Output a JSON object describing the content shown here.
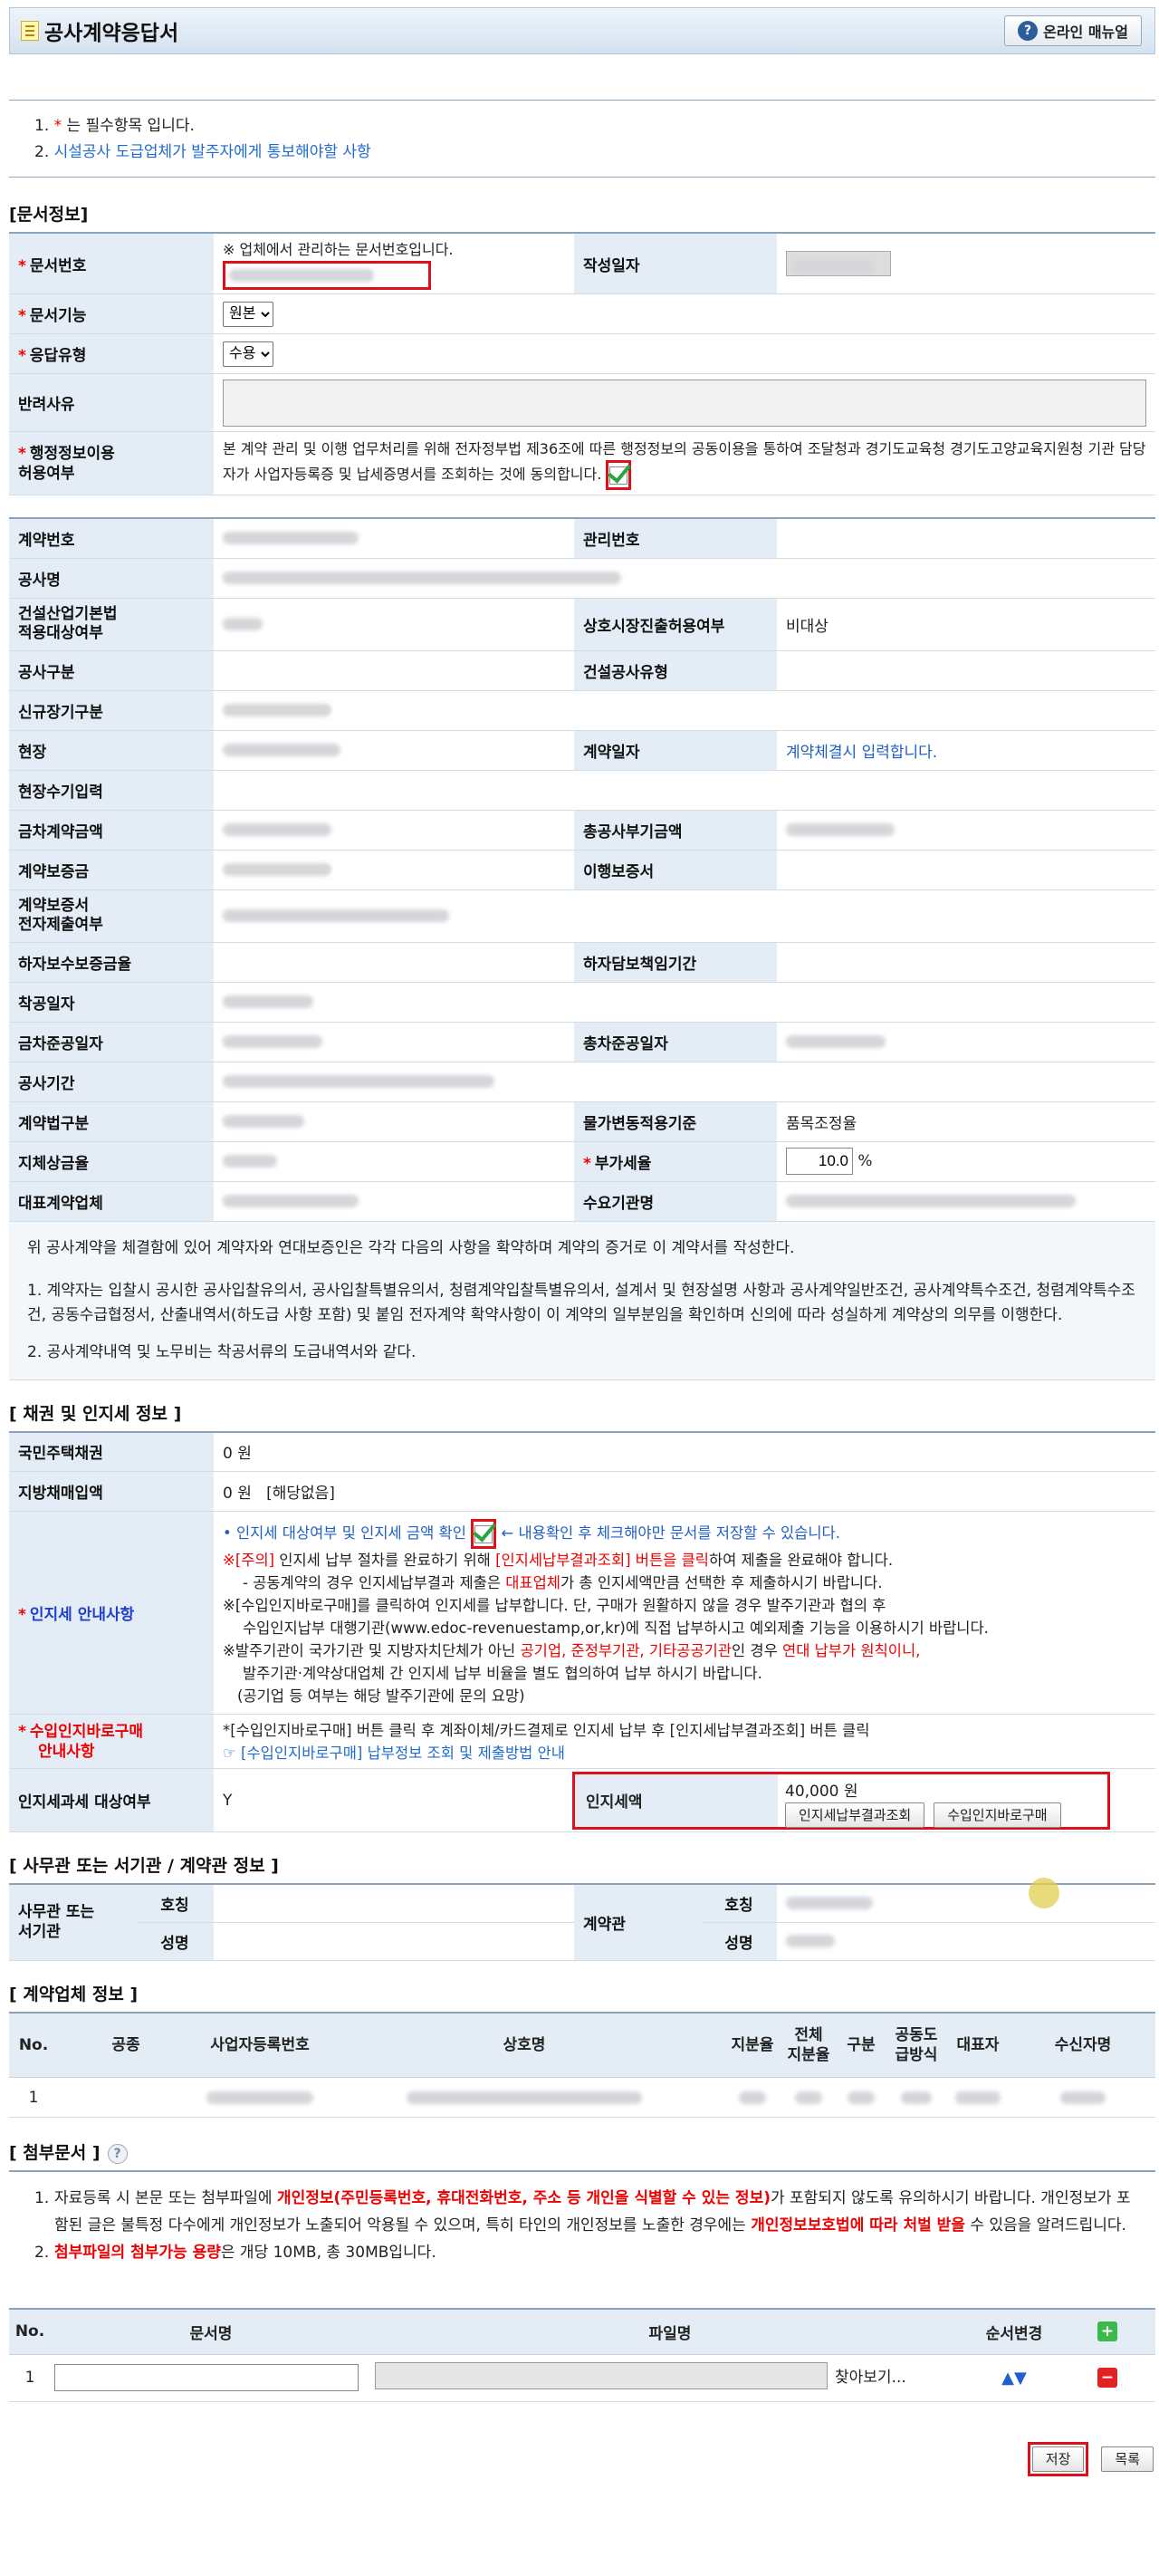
{
  "header": {
    "title": "공사계약응답서",
    "manual_label": "온라인 매뉴얼"
  },
  "notice": {
    "n1": "1.",
    "star": "*",
    "t1": " 는 필수항목 입니다.",
    "n2": "2.",
    "link": "시설공사 도급업체가 발주자에게 통보해야할 사항"
  },
  "doc": {
    "section": "[문서정보]",
    "docno_label": "문서번호",
    "docno_note": "※ 업체에서 관리하는 문서번호입니다.",
    "date_label": "작성일자",
    "func_label": "문서기능",
    "func_value": "원본",
    "resp_label": "응답유형",
    "resp_value": "수용",
    "reject_label": "반려사유",
    "consent_label1": "행정정보이용",
    "consent_label2": "허용여부",
    "consent_text": "본 계약 관리 및 이행 업무처리를 위해 전자정부법 제36조에 따른 행정정보의 공동이용을 통하여 조달청과 경기도교육청 경기도고양교육지원청 기관 담당자가 사업자등록증 및 납세증명서를 조회하는 것에 동의합니다."
  },
  "contract": {
    "labels": {
      "no": "계약번호",
      "mgmt": "관리번호",
      "name": "공사명",
      "law1": "건설산업기본법",
      "law2": "적용대상여부",
      "market": "상호시장진출허용여부",
      "market_value": "비대상",
      "kind": "공사구분",
      "ctype": "건설공사유형",
      "newlong": "신규장기구분",
      "site": "현장",
      "cdate": "계약일자",
      "cdate_value": "계약체결시 입력합니다.",
      "site_input": "현장수기입력",
      "amount": "금차계약금액",
      "total": "총공사부기금액",
      "guar": "계약보증금",
      "perf": "이행보증서",
      "elec1": "계약보증서",
      "elec2": "전자제출여부",
      "defect": "하자보수보증금율",
      "defect_period": "하자담보책임기간",
      "start": "착공일자",
      "end": "금차준공일자",
      "total_end": "총차준공일자",
      "period": "공사기간",
      "method": "계약법구분",
      "price": "물가변동적용기준",
      "price_value": "품목조정율",
      "delay": "지체상금율",
      "vat": "부가세율",
      "vat_value": "10.0",
      "vat_unit": "%",
      "rep": "대표계약업체",
      "demand": "수요기관명"
    },
    "para1": "위 공사계약을 체결함에 있어 계약자와 연대보증인은 각각 다음의 사항을 확약하며 계약의 증거로 이 계약서를 작성한다.",
    "para2": "1. 계약자는 입찰시 공시한 공사입찰유의서, 공사입찰특별유의서, 청렴계약입찰특별유의서, 설계서 및 현장설명 사항과 공사계약일반조건, 공사계약특수조건, 청렴계약특수조건, 공동수급협정서, 산출내역서(하도급 사항 포함) 및 붙임 전자계약 확약사항이 이 계약의 일부분임을 확인하며 신의에 따라 성실하게 계약상의 의무를 이행한다.",
    "para3": "2. 공사계약내역 및 노무비는 착공서류의 도급내역서와 같다."
  },
  "bond": {
    "section": "[ 채권 및 인지세 정보 ]",
    "housing_label": "국민주택채권",
    "housing_value": "0 원",
    "local_label": "지방채매입액",
    "local_value": "0 원",
    "local_note": "[해당없음]",
    "stamp_label": "인지세 안내사항",
    "l1a": "• 인지세 대상여부 및 인지세 금액 확인",
    "l1b": " ← 내용확인 후 체크해야만 문서를 저장할 수 있습니다.",
    "l2a": "※[주의]",
    "l2b": " 인지세 납부 절차를 완료하기 위해 ",
    "l2c": "[인지세납부결과조회] 버튼을 클릭",
    "l2d": "하여 제출을 완료해야 합니다.",
    "l3a": "- 공동계약의 경우 인지세납부결과 제출은 ",
    "l3b": "대표업체",
    "l3c": "가 총 인지세액만큼 선택한 후 제출하시기 바랍니다.",
    "l4": "※[수입인지바로구매]를 클릭하여 인지세를 납부합니다. 단, 구매가 원활하지 않을 경우 발주기관과 협의 후",
    "l5": "수입인지납부 대행기관(www.edoc-revenuestamp,or,kr)에 직접 납부하시고 예외제출 기능을 이용하시기 바랍니다.",
    "l6a": "※발주기관이 국가기관 및 지방자치단체가 아닌 ",
    "l6b": "공기업, 준정부기관, 기타공공기관",
    "l6c": "인 경우 ",
    "l6d": "연대 납부가 원칙이니,",
    "l7": "발주기관·계약상대업체 간 인지세 납부 비율을 별도 협의하여 납부 하시기 바랍니다.",
    "l8": "(공기업 등 여부는 해당 발주기관에 문의 요망)",
    "buy_label1": "수입인지바로구매",
    "buy_label2": "안내사항",
    "buy_text": "*[수입인지바로구매] 버튼 클릭 후 계좌이체/카드결제로 인지세 납부 후 [인지세납부결과조회] 버튼 클릭",
    "buy_link": "☞ [수입인지바로구매] 납부정보 조회 및 제출방법 안내",
    "target_label": "인지세과세 대상여부",
    "target_value": "Y",
    "amount_label": "인지세액",
    "amount_value": "40,000 원",
    "btn_result": "인지세납부결과조회",
    "btn_buy": "수입인지바로구매"
  },
  "office": {
    "section": "[ 사무관 또는 서기관 / 계약관 정보 ]",
    "l1": "사무관 또는",
    "l2": "서기관",
    "title": "호칭",
    "name": "성명",
    "officer": "계약관"
  },
  "company": {
    "section": "[ 계약업체 정보 ]",
    "headers": [
      "No.",
      "공종",
      "사업자등록번호",
      "상호명",
      "지분율",
      "전체\n지분율",
      "구분",
      "공동도\n급방식",
      "대표자",
      "수신자명"
    ],
    "row_no": "1"
  },
  "attach": {
    "section": "[ 첨부문서 ]",
    "help": "?",
    "i1_n": "1.",
    "i1a": "자료등록 시 본문 또는 첨부파일에 ",
    "i1b": "개인정보(주민등록번호, 휴대전화번호, 주소 등 개인을 식별할 수 있는 정보)",
    "i1c": "가 포함되지 않도록 유의하시기 바랍니다. 개인정보가 포함된 글은 불특정 다수에게 개인정보가 노출되어 악용될 수 있으며, 특히 타인의 개인정보를 노출한 경우에는 ",
    "i1d": "개인정보보호법에 따라 처벌 받을",
    "i1e": " 수 있음을 알려드립니다.",
    "i2_n": "2.",
    "i2a": "첨부파일의 첨부가능 용량",
    "i2b": "은 개당 10MB, 총 30MB입니다.",
    "headers": [
      "No.",
      "문서명",
      "파일명",
      "순서변경"
    ],
    "row_no": "1",
    "browse": "찾아보기...",
    "plus": "+",
    "minus": "−",
    "arrows": "▲▼"
  },
  "footer": {
    "save": "저장",
    "list": "목록"
  }
}
